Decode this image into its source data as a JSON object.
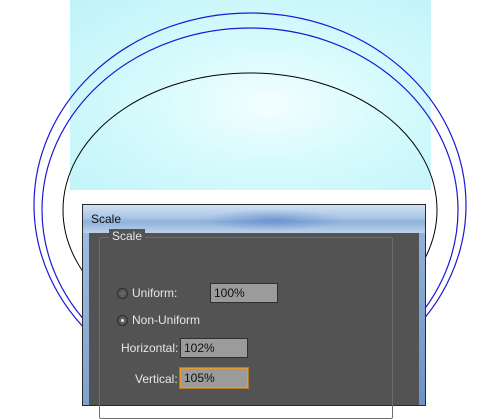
{
  "dialog": {
    "title": "Scale",
    "group_label": "Scale",
    "uniform": {
      "label": "Uniform:",
      "value": "100%",
      "selected": false
    },
    "non_uniform": {
      "label": "Non-Uniform",
      "selected": true
    },
    "horizontal": {
      "label": "Horizontal:",
      "value": "102%"
    },
    "vertical": {
      "label": "Vertical:",
      "value": "105%"
    }
  },
  "colors": {
    "artboard_fill": "#bff3f8",
    "selection_outline": "#1a1ad4",
    "path_stroke": "#000000",
    "dialog_bg": "#535353",
    "field_bg": "#9b9b9b",
    "focus_border": "#e59b2e"
  }
}
